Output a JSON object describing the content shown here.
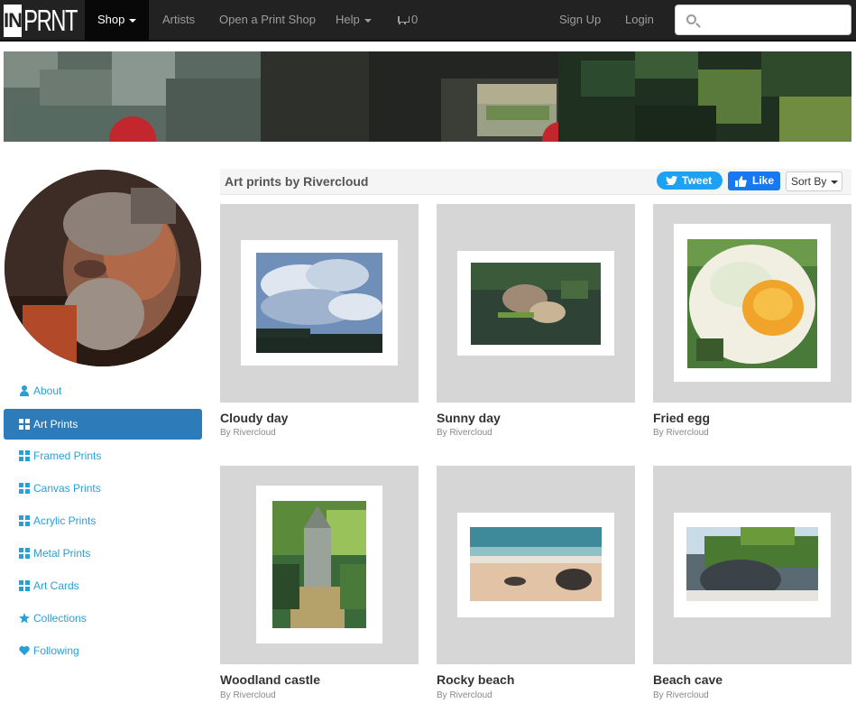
{
  "nav": {
    "logo_in": "IN",
    "logo_prnt": "PRNT",
    "shop": "Shop",
    "artists": "Artists",
    "open_shop": "Open a Print Shop",
    "help": "Help",
    "cart_count": "0",
    "sign_up": "Sign Up",
    "login": "Login",
    "search_placeholder": ""
  },
  "sidebar": {
    "items": [
      {
        "label": "About",
        "icon": "user-icon"
      },
      {
        "label": "Art Prints",
        "icon": "grid-icon",
        "active": true
      },
      {
        "label": "Framed Prints",
        "icon": "grid-icon"
      },
      {
        "label": "Canvas Prints",
        "icon": "grid-icon"
      },
      {
        "label": "Acrylic Prints",
        "icon": "grid-icon"
      },
      {
        "label": "Metal Prints",
        "icon": "grid-icon"
      },
      {
        "label": "Art Cards",
        "icon": "grid-icon"
      },
      {
        "label": "Collections",
        "icon": "star-icon"
      },
      {
        "label": "Following",
        "icon": "heart-icon"
      }
    ]
  },
  "content": {
    "title": "Art prints by Rivercloud",
    "tweet": "Tweet",
    "like": "Like",
    "sort": "Sort By"
  },
  "products": [
    {
      "title": "Cloudy day",
      "by": "By Rivercloud"
    },
    {
      "title": "Sunny day",
      "by": "By Rivercloud"
    },
    {
      "title": "Fried egg",
      "by": "By Rivercloud"
    },
    {
      "title": "Woodland castle",
      "by": "By Rivercloud"
    },
    {
      "title": "Rocky beach",
      "by": "By Rivercloud"
    },
    {
      "title": "Beach cave",
      "by": "By Rivercloud"
    }
  ],
  "colors": {
    "navbar": "#222222",
    "link": "#2a9fd6",
    "active": "#2d7bb8",
    "tweet": "#1da1f2",
    "like": "#1877f2"
  }
}
